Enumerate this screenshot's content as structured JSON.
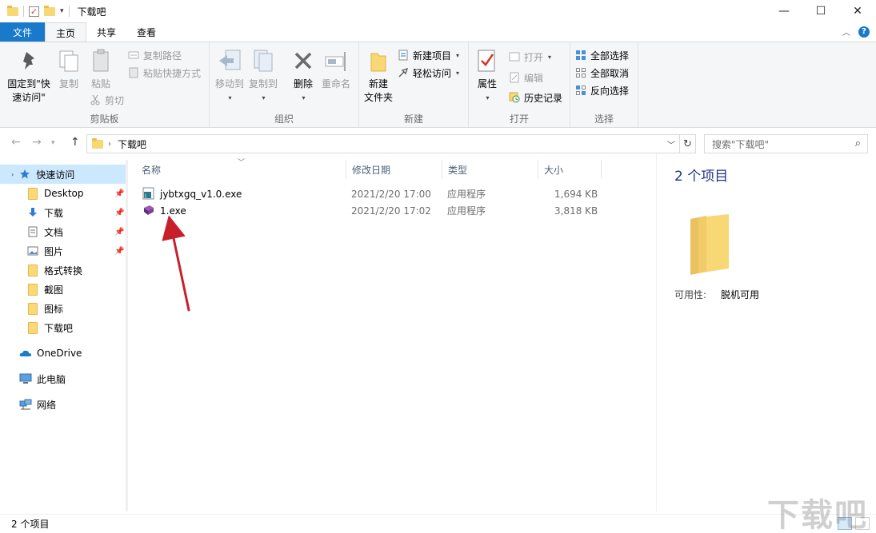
{
  "window": {
    "title": "下载吧",
    "controls": {
      "minimize": "—",
      "maximize": "☐",
      "close": "✕"
    }
  },
  "ribbon_tabs": [
    {
      "label": "文件"
    },
    {
      "label": "主页"
    },
    {
      "label": "共享"
    },
    {
      "label": "查看"
    }
  ],
  "ribbon": {
    "clipboard": {
      "pin_quick_access": [
        "固定到\"快",
        "速访问\""
      ],
      "copy": "复制",
      "paste": "粘贴",
      "copy_path": "复制路径",
      "paste_shortcut": "粘贴快捷方式",
      "cut": "剪切",
      "group_label": "剪贴板"
    },
    "organize": {
      "move_to": "移动到",
      "copy_to": "复制到",
      "delete": "删除",
      "rename": "重命名",
      "group_label": "组织"
    },
    "new": {
      "new_folder": [
        "新建",
        "文件夹"
      ],
      "new_item": "新建项目",
      "easy_access": "轻松访问",
      "group_label": "新建"
    },
    "open": {
      "properties": "属性",
      "open": "打开",
      "edit": "编辑",
      "history": "历史记录",
      "group_label": "打开"
    },
    "select": {
      "select_all": "全部选择",
      "select_none": "全部取消",
      "invert": "反向选择",
      "group_label": "选择"
    }
  },
  "address": {
    "path": "下载吧",
    "search_placeholder": "搜索\"下载吧\""
  },
  "nav_pane": {
    "quick_access": "快速访问",
    "items": [
      {
        "label": "Desktop",
        "pinned": true
      },
      {
        "label": "下载",
        "pinned": true
      },
      {
        "label": "文档",
        "pinned": true
      },
      {
        "label": "图片",
        "pinned": true
      },
      {
        "label": "格式转换",
        "pinned": false
      },
      {
        "label": "截图",
        "pinned": false
      },
      {
        "label": "图标",
        "pinned": false
      },
      {
        "label": "下载吧",
        "pinned": false
      }
    ],
    "onedrive": "OneDrive",
    "this_pc": "此电脑",
    "network": "网络"
  },
  "file_list": {
    "columns": {
      "name": "名称",
      "date": "修改日期",
      "type": "类型",
      "size": "大小"
    },
    "rows": [
      {
        "name": "jybtxgq_v1.0.exe",
        "date": "2021/2/20 17:00",
        "type": "应用程序",
        "size": "1,694 KB"
      },
      {
        "name": "1.exe",
        "date": "2021/2/20 17:02",
        "type": "应用程序",
        "size": "3,818 KB"
      }
    ]
  },
  "details_pane": {
    "title": "2 个项目",
    "availability_label": "可用性:",
    "availability_value": "脱机可用"
  },
  "status_bar": {
    "text": "2 个项目"
  },
  "watermark": "下载吧",
  "colors": {
    "file_tab": "#1979ca",
    "selection": "#cce8ff",
    "annotation_arrow": "#c8202a",
    "folder": "#f8d775"
  }
}
